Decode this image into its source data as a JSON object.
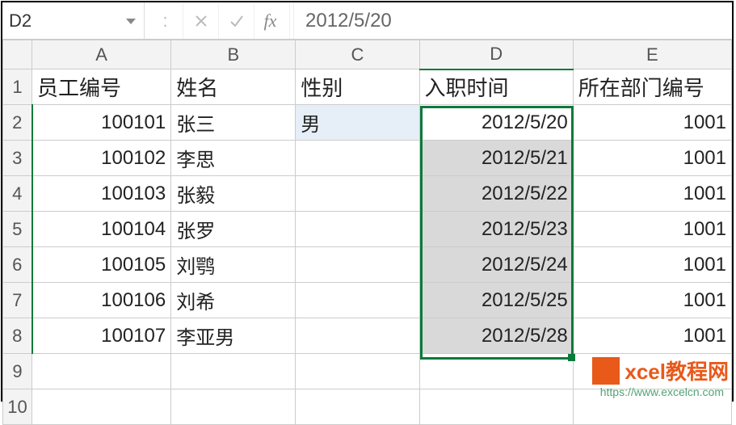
{
  "formula_bar": {
    "name_box": "D2",
    "fx_label": "fx",
    "value": "2012/5/20"
  },
  "columns": {
    "corner": "",
    "A": "A",
    "B": "B",
    "C": "C",
    "D": "D",
    "E": "E"
  },
  "row_headers": [
    "1",
    "2",
    "3",
    "4",
    "5",
    "6",
    "7",
    "8",
    "9",
    "10"
  ],
  "headers": {
    "A": "员工编号",
    "B": "姓名",
    "C": "性别",
    "D": "入职时间",
    "E": "所在部门编号"
  },
  "rows": [
    {
      "A": "100101",
      "B": "张三",
      "C": "男",
      "D": "2012/5/20",
      "E": "1001"
    },
    {
      "A": "100102",
      "B": "李思",
      "C": "",
      "D": "2012/5/21",
      "E": "1001"
    },
    {
      "A": "100103",
      "B": "张毅",
      "C": "",
      "D": "2012/5/22",
      "E": "1001"
    },
    {
      "A": "100104",
      "B": "张罗",
      "C": "",
      "D": "2012/5/23",
      "E": "1001"
    },
    {
      "A": "100105",
      "B": "刘鹗",
      "C": "",
      "D": "2012/5/24",
      "E": "1001"
    },
    {
      "A": "100106",
      "B": "刘希",
      "C": "",
      "D": "2012/5/25",
      "E": "1001"
    },
    {
      "A": "100107",
      "B": "李亚男",
      "C": "",
      "D": "2012/5/28",
      "E": "1001"
    }
  ],
  "watermark": {
    "brand": "xcel教程网",
    "url": "https://www.excelcn.com"
  }
}
